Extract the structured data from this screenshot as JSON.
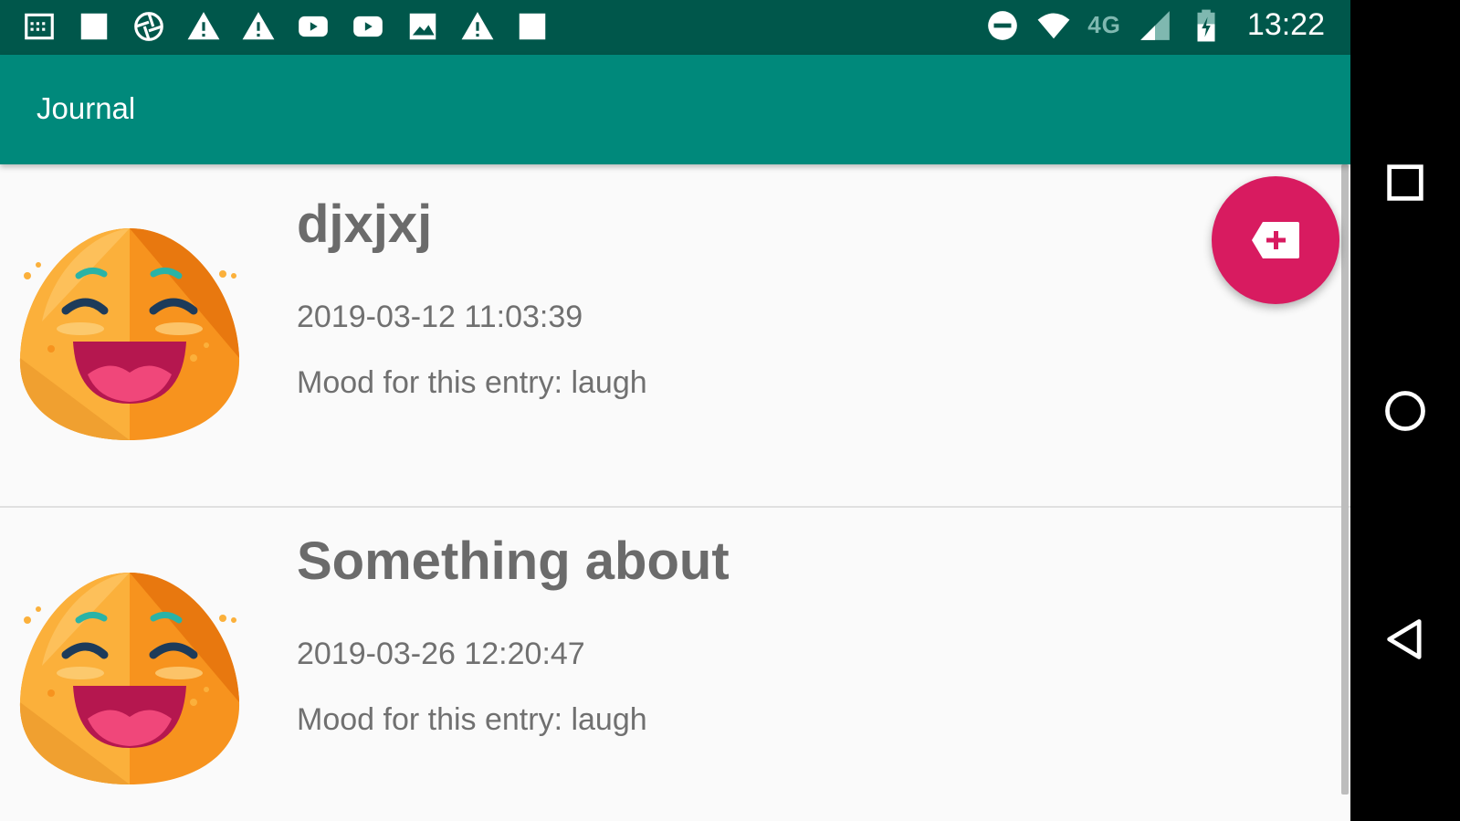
{
  "status_bar": {
    "time": "13:22",
    "network": "4G",
    "notification_icons": [
      "calendar-icon",
      "square-icon",
      "aperture-icon",
      "warning-icon",
      "warning-icon",
      "youtube-icon",
      "youtube-icon",
      "image-icon",
      "warning-icon",
      "square-icon"
    ],
    "system_icons": [
      "do-not-disturb-icon",
      "wifi-icon",
      "cell-signal-icon",
      "battery-charging-icon"
    ]
  },
  "app_bar": {
    "title": "Journal"
  },
  "entries": [
    {
      "title": "djxjxj",
      "date": "2019-03-12 11:03:39",
      "mood": "Mood for this entry: laugh",
      "emoji": "laughing-emoji-icon"
    },
    {
      "title": "Something about",
      "date": "2019-03-26 12:20:47",
      "mood": "Mood for this entry: laugh",
      "emoji": "laughing-emoji-icon"
    }
  ],
  "fab": {
    "icon": "add-label-icon"
  },
  "nav_bar": {
    "buttons": [
      "recents-icon",
      "home-icon",
      "back-icon"
    ]
  },
  "colors": {
    "status_bar": "#00574b",
    "app_bar": "#00897b",
    "fab": "#d81b60",
    "background": "#fafafa"
  }
}
